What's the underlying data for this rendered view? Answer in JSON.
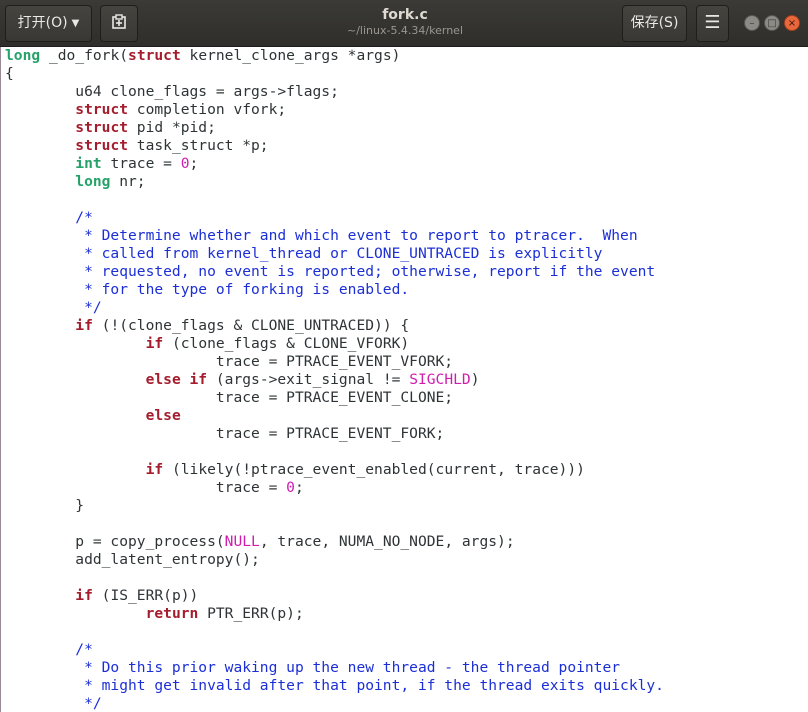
{
  "header": {
    "open_label": "打开(O)",
    "save_label": "保存(S)",
    "title": "fork.c",
    "subtitle": "~/linux-5.4.34/kernel"
  },
  "icons": {
    "open_dropdown": "chevron-down-icon",
    "new_document": "new-document-icon",
    "menu": "hamburger-menu-icon",
    "minimize": "minimize-icon",
    "maximize": "maximize-icon",
    "close": "close-icon"
  },
  "colors": {
    "keyword": "#a51d2d",
    "type": "#26a269",
    "constant": "#d01dae",
    "comment": "#1c2fd6",
    "close_button": "#e9673c"
  },
  "code_lines": [
    [
      [
        "t",
        "long"
      ],
      [
        "p",
        " _do_fork("
      ],
      [
        "k",
        "struct"
      ],
      [
        "p",
        " kernel_clone_args *args)"
      ]
    ],
    [
      [
        "p",
        "{"
      ]
    ],
    [
      [
        "p",
        "        u64 clone_flags = args->flags;"
      ]
    ],
    [
      [
        "p",
        "        "
      ],
      [
        "k",
        "struct"
      ],
      [
        "p",
        " completion vfork;"
      ]
    ],
    [
      [
        "p",
        "        "
      ],
      [
        "k",
        "struct"
      ],
      [
        "p",
        " pid *pid;"
      ]
    ],
    [
      [
        "p",
        "        "
      ],
      [
        "k",
        "struct"
      ],
      [
        "p",
        " task_struct *p;"
      ]
    ],
    [
      [
        "p",
        "        "
      ],
      [
        "t",
        "int"
      ],
      [
        "p",
        " trace = "
      ],
      [
        "n",
        "0"
      ],
      [
        "p",
        ";"
      ]
    ],
    [
      [
        "p",
        "        "
      ],
      [
        "t",
        "long"
      ],
      [
        "p",
        " nr;"
      ]
    ],
    [
      [
        "p",
        ""
      ]
    ],
    [
      [
        "p",
        "        "
      ],
      [
        "c",
        "/*"
      ]
    ],
    [
      [
        "c",
        "         * Determine whether and which event to report to ptracer.  When"
      ]
    ],
    [
      [
        "c",
        "         * called from kernel_thread or CLONE_UNTRACED is explicitly"
      ]
    ],
    [
      [
        "c",
        "         * requested, no event is reported; otherwise, report if the event"
      ]
    ],
    [
      [
        "c",
        "         * for the type of forking is enabled."
      ]
    ],
    [
      [
        "c",
        "         */"
      ]
    ],
    [
      [
        "p",
        "        "
      ],
      [
        "k",
        "if"
      ],
      [
        "p",
        " (!(clone_flags & CLONE_UNTRACED)) {"
      ]
    ],
    [
      [
        "p",
        "                "
      ],
      [
        "k",
        "if"
      ],
      [
        "p",
        " (clone_flags & CLONE_VFORK)"
      ]
    ],
    [
      [
        "p",
        "                        trace = PTRACE_EVENT_VFORK;"
      ]
    ],
    [
      [
        "p",
        "                "
      ],
      [
        "k",
        "else if"
      ],
      [
        "p",
        " (args->exit_signal != "
      ],
      [
        "n",
        "SIGCHLD"
      ],
      [
        "p",
        ")"
      ]
    ],
    [
      [
        "p",
        "                        trace = PTRACE_EVENT_CLONE;"
      ]
    ],
    [
      [
        "p",
        "                "
      ],
      [
        "k",
        "else"
      ]
    ],
    [
      [
        "p",
        "                        trace = PTRACE_EVENT_FORK;"
      ]
    ],
    [
      [
        "p",
        ""
      ]
    ],
    [
      [
        "p",
        "                "
      ],
      [
        "k",
        "if"
      ],
      [
        "p",
        " (likely(!ptrace_event_enabled(current, trace)))"
      ]
    ],
    [
      [
        "p",
        "                        trace = "
      ],
      [
        "n",
        "0"
      ],
      [
        "p",
        ";"
      ]
    ],
    [
      [
        "p",
        "        }"
      ]
    ],
    [
      [
        "p",
        ""
      ]
    ],
    [
      [
        "p",
        "        p = copy_process("
      ],
      [
        "n",
        "NULL"
      ],
      [
        "p",
        ", trace, NUMA_NO_NODE, args);"
      ]
    ],
    [
      [
        "p",
        "        add_latent_entropy();"
      ]
    ],
    [
      [
        "p",
        ""
      ]
    ],
    [
      [
        "p",
        "        "
      ],
      [
        "k",
        "if"
      ],
      [
        "p",
        " (IS_ERR(p))"
      ]
    ],
    [
      [
        "p",
        "                "
      ],
      [
        "k",
        "return"
      ],
      [
        "p",
        " PTR_ERR(p);"
      ]
    ],
    [
      [
        "p",
        ""
      ]
    ],
    [
      [
        "p",
        "        "
      ],
      [
        "c",
        "/*"
      ]
    ],
    [
      [
        "c",
        "         * Do this prior waking up the new thread - the thread pointer"
      ]
    ],
    [
      [
        "c",
        "         * might get invalid after that point, if the thread exits quickly."
      ]
    ],
    [
      [
        "c",
        "         */"
      ]
    ]
  ]
}
